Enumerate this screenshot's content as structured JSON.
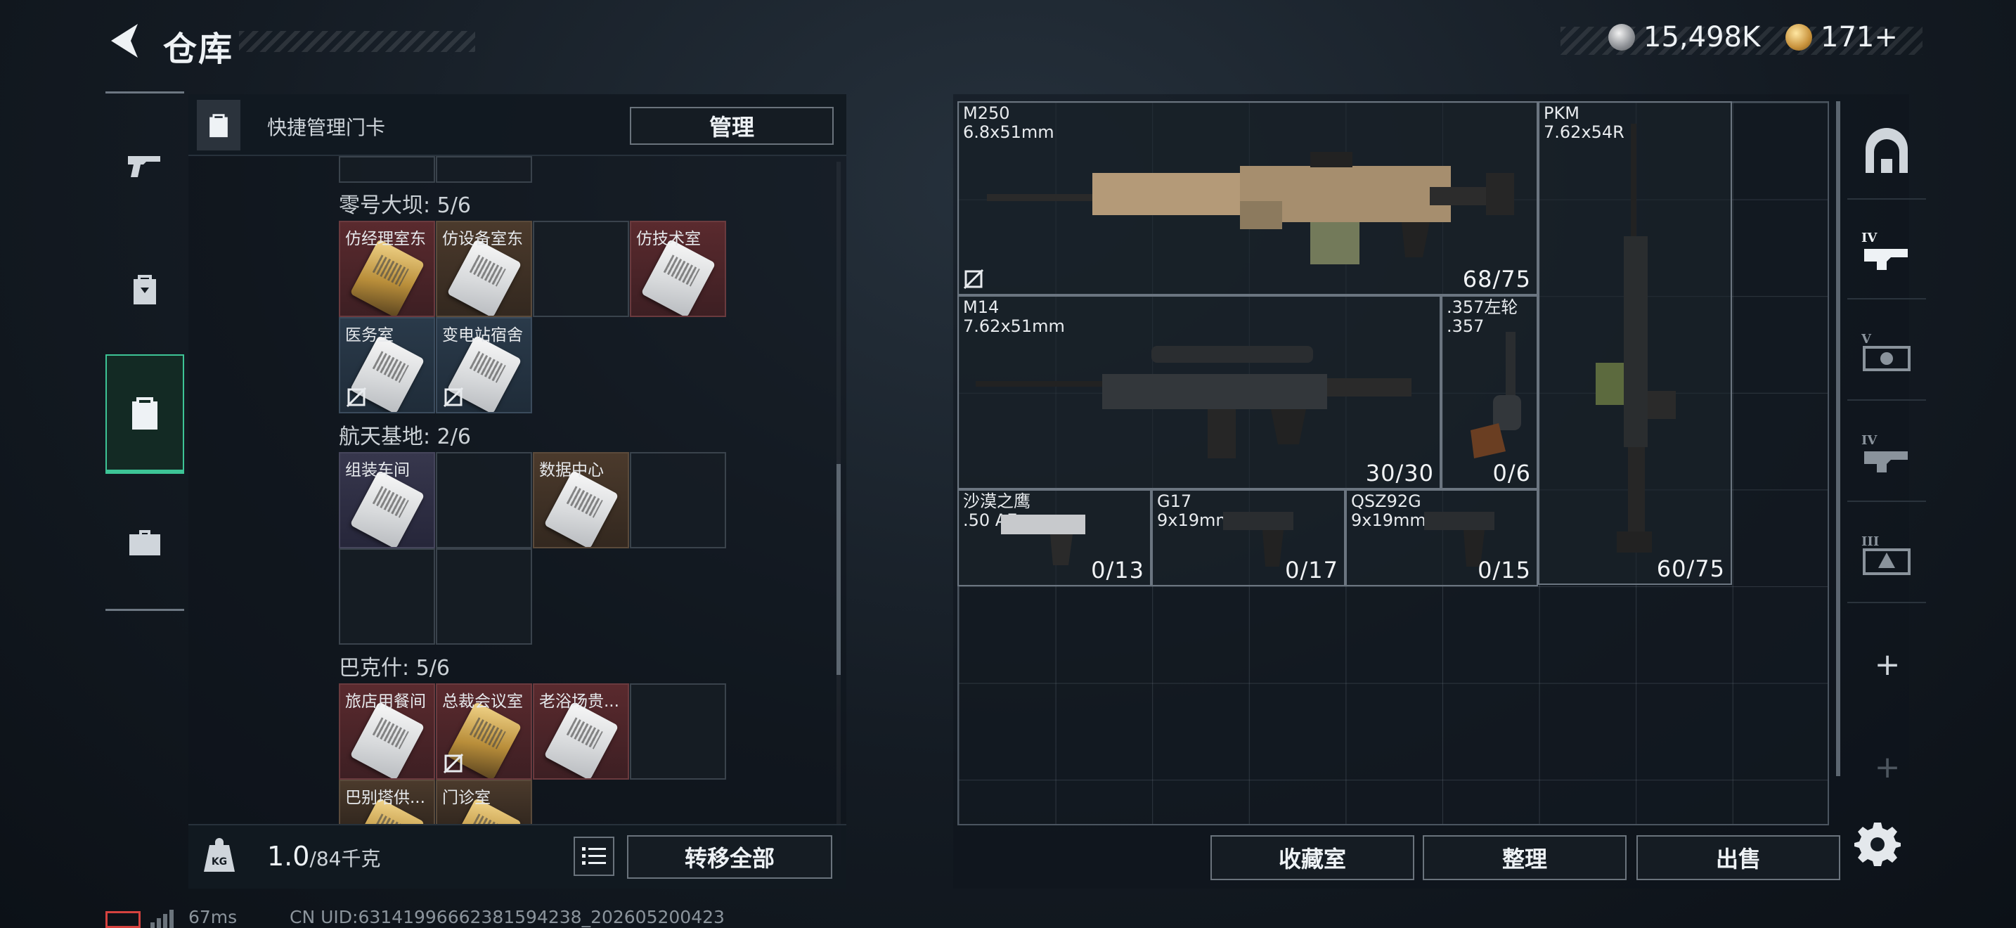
{
  "header": {
    "title": "仓库",
    "currencies": [
      {
        "icon": "silver-coin-icon",
        "value": "15,498K"
      },
      {
        "icon": "gold-coin-icon",
        "value": "171+"
      }
    ]
  },
  "left_rail": {
    "items": [
      {
        "name": "weapons",
        "icon": "pistol-icon",
        "active": false
      },
      {
        "name": "backpack",
        "icon": "backpack-icon",
        "active": false
      },
      {
        "name": "keycards",
        "icon": "keycard-holder-icon",
        "active": true
      },
      {
        "name": "toolbox",
        "icon": "briefcase-icon",
        "active": false
      }
    ]
  },
  "keycards": {
    "quick_manage_label": "快捷管理门卡",
    "manage_button": "管理",
    "sections": [
      {
        "title": "零号大坝: 5/6",
        "cards": [
          {
            "name": "仿经理室东",
            "color": "red",
            "card": "gold",
            "no_export": false
          },
          {
            "name": "仿设备室东",
            "color": "brown",
            "card": "white",
            "no_export": false
          },
          {
            "name": "",
            "color": "empty",
            "card": "",
            "no_export": false
          },
          {
            "name": "仿技术室",
            "color": "red",
            "card": "white",
            "no_export": false
          },
          {
            "name": "医务室",
            "color": "blue",
            "card": "white",
            "no_export": true
          },
          {
            "name": "变电站宿舍",
            "color": "blue",
            "card": "white",
            "no_export": true
          }
        ]
      },
      {
        "title": "航天基地: 2/6",
        "cards": [
          {
            "name": "组装车间",
            "color": "purple",
            "card": "white",
            "no_export": false
          },
          {
            "name": "",
            "color": "empty",
            "card": "",
            "no_export": false
          },
          {
            "name": "数据中心",
            "color": "brown",
            "card": "white",
            "no_export": false
          },
          {
            "name": "",
            "color": "empty",
            "card": "",
            "no_export": false
          },
          {
            "name": "",
            "color": "empty",
            "card": "",
            "no_export": false
          },
          {
            "name": "",
            "color": "empty",
            "card": "",
            "no_export": false
          }
        ]
      },
      {
        "title": "巴克什: 5/6",
        "cards": [
          {
            "name": "旅店用餐间",
            "color": "red",
            "card": "white",
            "no_export": false
          },
          {
            "name": "总裁会议室",
            "color": "red",
            "card": "gold",
            "no_export": true
          },
          {
            "name": "老浴场贵...",
            "color": "red",
            "card": "white",
            "no_export": false
          },
          {
            "name": "",
            "color": "empty",
            "card": "",
            "no_export": false
          },
          {
            "name": "巴别塔供...",
            "color": "brown",
            "card": "gold",
            "no_export": false
          },
          {
            "name": "门诊室",
            "color": "brown",
            "card": "gold",
            "no_export": false
          }
        ]
      }
    ],
    "weight_value": "1.0",
    "weight_capacity": "/84千克",
    "transfer_all_button": "转移全部"
  },
  "storage": {
    "items": [
      {
        "id": "m250",
        "name": "M250",
        "caliber": "6.8x51mm",
        "ammo": "68/75",
        "no_export": true
      },
      {
        "id": "pkm",
        "name": "PKM",
        "caliber": "7.62x54R",
        "ammo": "60/75",
        "no_export": false
      },
      {
        "id": "m14",
        "name": "M14",
        "caliber": "7.62x51mm",
        "ammo": "30/30",
        "no_export": false
      },
      {
        "id": "rev",
        "name": ".357左轮",
        "caliber": ".357",
        "ammo": "0/6",
        "no_export": false
      },
      {
        "id": "deagle",
        "name": "沙漠之鹰",
        "caliber": ".50 AE",
        "ammo": "0/13",
        "no_export": false
      },
      {
        "id": "g17",
        "name": "G17",
        "caliber": "9x19mm",
        "ammo": "0/17",
        "no_export": false
      },
      {
        "id": "qsz",
        "name": "QSZ92G",
        "caliber": "9x19mm",
        "ammo": "0/15",
        "no_export": false
      }
    ],
    "buttons": {
      "collection": "收藏室",
      "sort": "整理",
      "sell": "出售"
    }
  },
  "right_rail": {
    "items": [
      {
        "icon": "safehouse-icon"
      },
      {
        "icon": "tier-4-gun-icon",
        "tier": "IV"
      },
      {
        "icon": "tier-5-gun-icon",
        "tier": "V"
      },
      {
        "icon": "tier-4-gun-icon",
        "tier": "IV"
      },
      {
        "icon": "tier-3-gun-icon",
        "tier": "III"
      }
    ],
    "plus": "+"
  },
  "status_bar": {
    "ping": "67ms",
    "uid": "CN UID:6314199666238159423​8_202605200423"
  }
}
